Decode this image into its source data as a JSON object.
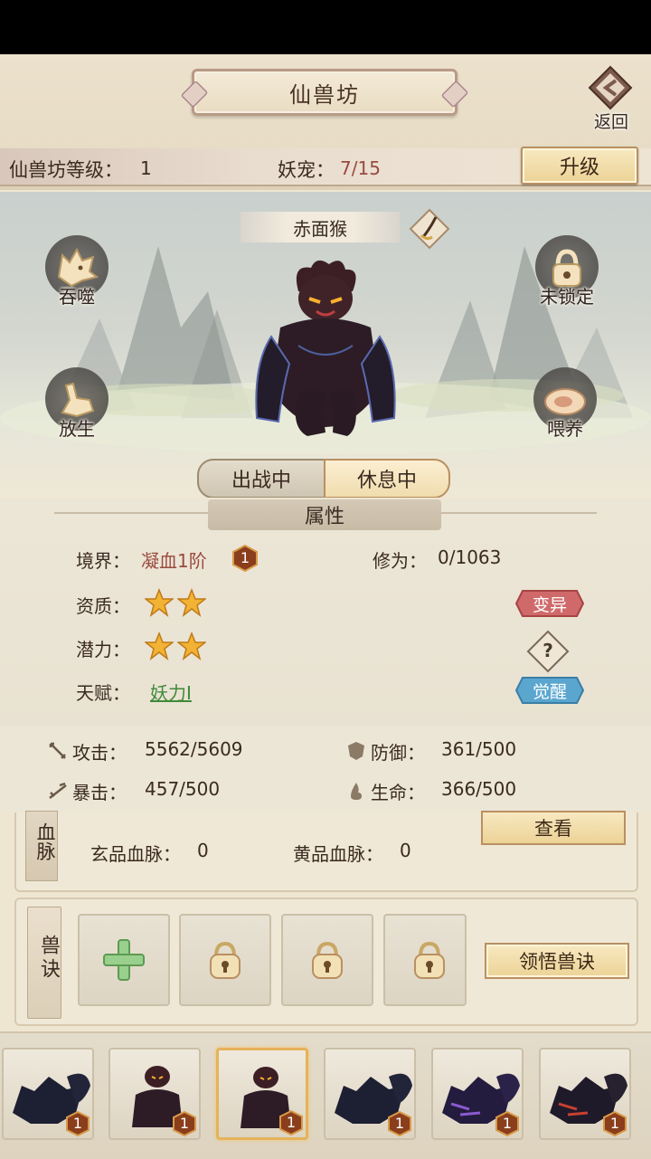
{
  "header": {
    "title": "仙兽坊",
    "back_label": "返回",
    "level_label": "仙兽坊等级：",
    "level_value": "1",
    "pet_label": "妖宠：",
    "pet_value": "7/15",
    "upgrade_label": "升级"
  },
  "beast": {
    "name": "赤面猴",
    "actions": {
      "devour": "吞噬",
      "lock": "未锁定",
      "release": "放生",
      "feed": "喂养"
    },
    "status": {
      "battle": "出战中",
      "rest": "休息中"
    }
  },
  "attributes": {
    "header": "属性",
    "realm_label": "境界：",
    "realm_value": "凝血1阶",
    "realm_badge": "1",
    "cultivation_label": "修为：",
    "cultivation_value": "0/1063",
    "aptitude_label": "资质：",
    "aptitude_stars": 2,
    "potential_label": "潜力：",
    "potential_stars": 2,
    "talent_label": "天赋：",
    "talent_value": "妖力I",
    "mutate_label": "变异",
    "help_label": "?",
    "awaken_label": "觉醒"
  },
  "stats": {
    "attack_label": "攻击：",
    "attack_value": "5562/5609",
    "defense_label": "防御：",
    "defense_value": "361/500",
    "crit_label": "暴击：",
    "crit_value": "457/500",
    "life_label": "生命：",
    "life_value": "366/500"
  },
  "bloodline": {
    "tab_label": "血脉",
    "view_label": "查看",
    "xuan_label": "玄品血脉：",
    "xuan_value": "0",
    "huang_label": "黄品血脉：",
    "huang_value": "0"
  },
  "skills": {
    "tab_label": "兽诀",
    "learn_label": "领悟兽诀"
  },
  "roster": {
    "pets": [
      {
        "level": "1"
      },
      {
        "level": "1"
      },
      {
        "level": "1"
      },
      {
        "level": "1"
      },
      {
        "level": "1"
      },
      {
        "level": "1"
      }
    ]
  },
  "colors": {
    "accent_red": "#9a4a3e",
    "talent_green": "#3f8a3a",
    "mutate_red": "#d06a6a",
    "awaken_blue": "#5aa6cf",
    "star_gold": "#f2b233"
  }
}
